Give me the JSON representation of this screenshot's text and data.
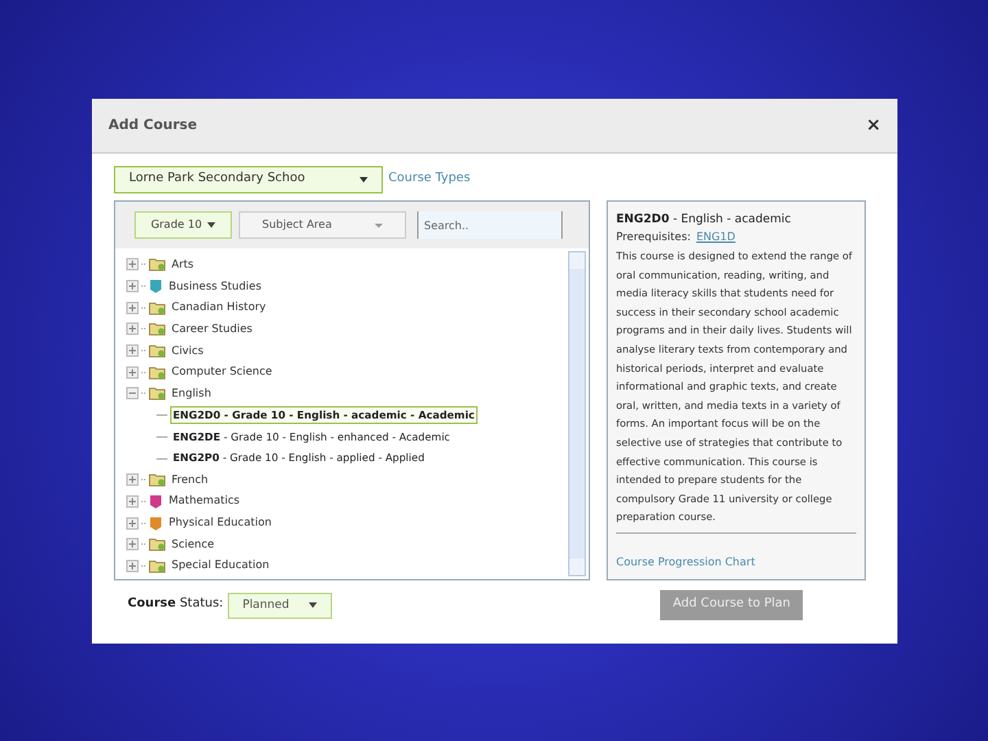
{
  "dialog": {
    "title": "Add Course",
    "close": "×"
  },
  "school_select": {
    "value": "Lorne Park Secondary Schoo"
  },
  "course_types_link": "Course Types",
  "filters": {
    "grade": "Grade 10",
    "subject": "Subject Area",
    "search_placeholder": "Search.."
  },
  "tree": [
    {
      "label": "Arts",
      "kind": "folder",
      "expanded": false
    },
    {
      "label": "Business Studies",
      "kind": "tag",
      "color": "#3aa6b9",
      "expanded": false
    },
    {
      "label": "Canadian History",
      "kind": "folder",
      "expanded": false
    },
    {
      "label": "Career Studies",
      "kind": "folder",
      "expanded": false
    },
    {
      "label": "Civics",
      "kind": "folder",
      "expanded": false
    },
    {
      "label": "Computer Science",
      "kind": "folder",
      "expanded": false
    },
    {
      "label": "English",
      "kind": "folder",
      "expanded": true,
      "children": [
        {
          "code": "ENG2D0",
          "title": " - Grade 10 - English - academic - Academic",
          "selected": true
        },
        {
          "code": "ENG2DE",
          "title": " - Grade 10 - English - enhanced - Academic",
          "selected": false
        },
        {
          "code": "ENG2P0",
          "title": " - Grade 10 - English - applied - Applied",
          "selected": false
        }
      ]
    },
    {
      "label": "French",
      "kind": "folder",
      "expanded": false
    },
    {
      "label": "Mathematics",
      "kind": "tag",
      "color": "#d03a8a",
      "expanded": false
    },
    {
      "label": "Physical Education",
      "kind": "tag",
      "color": "#e08a2a",
      "expanded": false
    },
    {
      "label": "Science",
      "kind": "folder",
      "expanded": false
    },
    {
      "label": "Special Education",
      "kind": "folder",
      "expanded": false
    }
  ],
  "details": {
    "heading": "**ENG2D0** - English - academic",
    "prerequisites_label": "Prerequisites:",
    "prerequisites_link": "ENG1D",
    "description": "This course is designed to extend the range of oral communication, reading, writing, and media literacy skills that students need for success in their secondary school academic programs and in their daily lives. Students will analyse literary texts from contemporary and historical periods, interpret and evaluate informational and graphic texts, and create oral, written, and media texts in a variety of forms. An important focus will be on the selective use of strategies that contribute to effective communication. This course is intended to prepare students for the compulsory Grade 11 university or college preparation course.",
    "progression_link": "Course Progression Chart"
  },
  "course_status": {
    "label": "**Course** Status:",
    "value": "Planned"
  },
  "add_button": {
    "label": "Add Course to Plan",
    "disabled": true
  }
}
